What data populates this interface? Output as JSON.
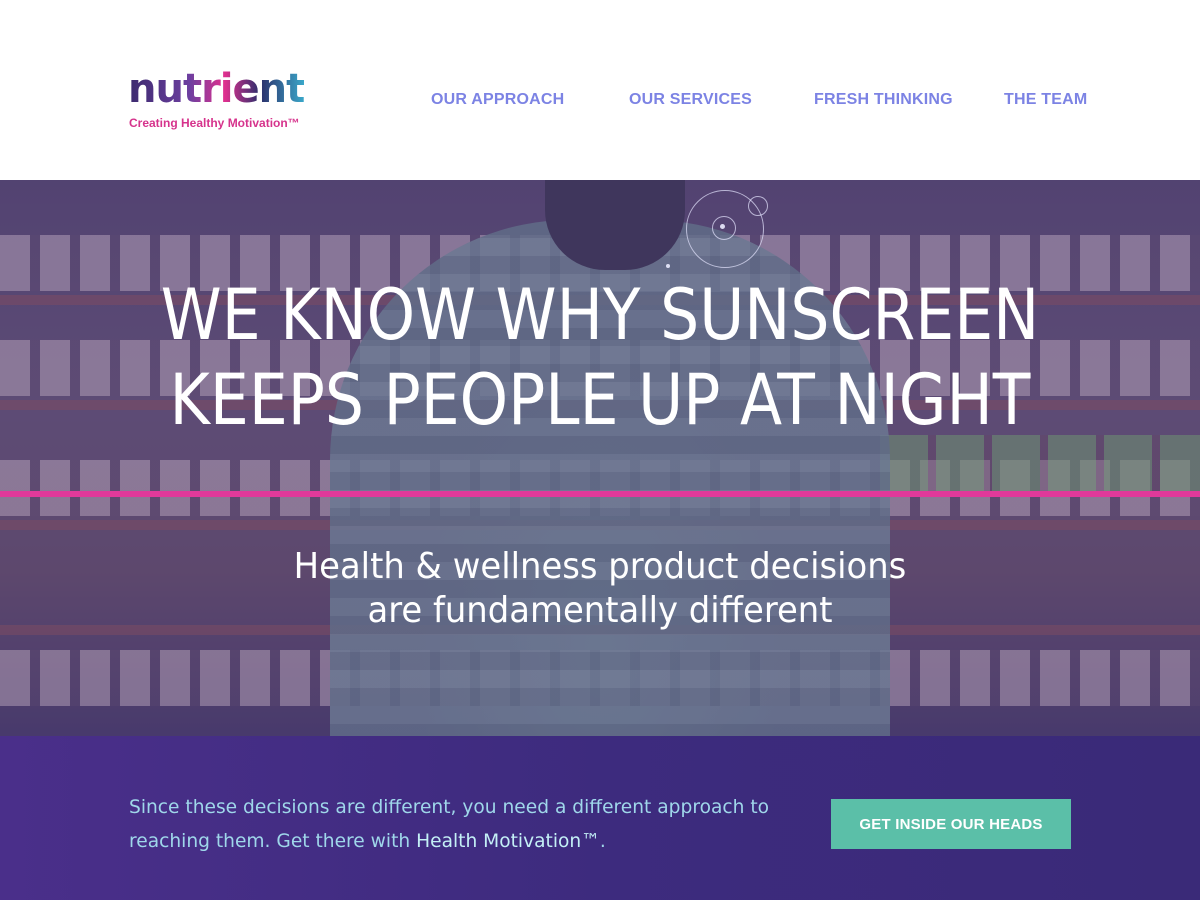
{
  "brand": {
    "logo_text": "nutrient",
    "tagline": "Creating Healthy Motivation™"
  },
  "nav": {
    "items": [
      {
        "label": "OUR APPROACH"
      },
      {
        "label": "OUR SERVICES"
      },
      {
        "label": "FRESH THINKING"
      },
      {
        "label": "THE TEAM"
      }
    ]
  },
  "hero": {
    "headline_line1": "WE KNOW WHY SUNSCREEN",
    "headline_line2": "KEEPS PEOPLE UP AT NIGHT",
    "subline_line1": "Health & wellness product decisions",
    "subline_line2": "are fundamentally different"
  },
  "cta": {
    "text_before": "Since these decisions are different, you need a different approach to reaching them. Get there with ",
    "text_highlight": "Health Motivation™",
    "text_after": ".",
    "button_label": "GET INSIDE OUR HEADS"
  },
  "colors": {
    "nav": "#7c83e4",
    "accent_pink": "#e0399a",
    "band": "#3d2b7e",
    "button": "#5bbfa8"
  }
}
